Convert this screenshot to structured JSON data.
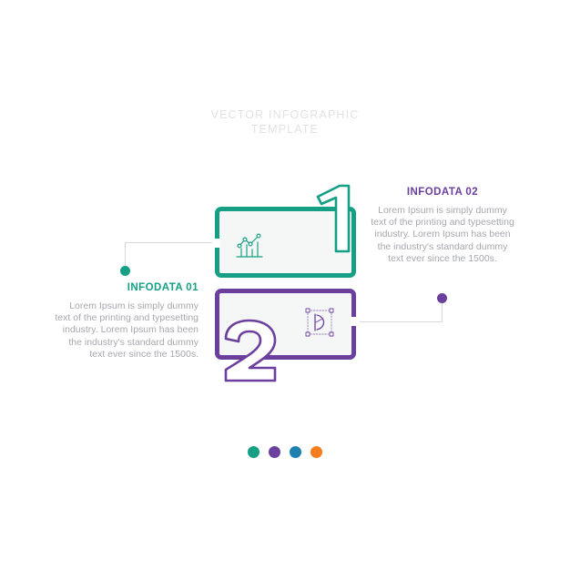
{
  "header": {
    "title": "VECTOR INFOGRAPHIC\nTEMPLATE"
  },
  "colors": {
    "teal": "#15a085",
    "purple": "#6b3f9e",
    "blue": "#1f7fae",
    "orange": "#f57d1f",
    "body_text": "#a7a8ad",
    "title_text": "#e2e2e4",
    "card_fill": "#f5f6f6",
    "connector_line": "#d8d8dc"
  },
  "steps": [
    {
      "number": "1",
      "heading": "INFODATA 01",
      "body": "Lorem Ipsum is simply dummy text of the printing and typesetting industry. Lorem Ipsum has been the industry's standard dummy text ever since the 1500s.",
      "icon": "growth-chart-icon",
      "accent": "#15a085"
    },
    {
      "number": "2",
      "heading": "INFODATA 02",
      "body": "Lorem Ipsum is simply dummy text of the printing and typesetting industry. Lorem Ipsum has been the industry's standard dummy text ever since the 1500s.",
      "icon": "vector-path-icon",
      "accent": "#6b3f9e"
    }
  ],
  "footer": {
    "dots": [
      {
        "color": "#15a085",
        "name": "footer-dot-teal"
      },
      {
        "color": "#6b3f9e",
        "name": "footer-dot-purple"
      },
      {
        "color": "#1f7fae",
        "name": "footer-dot-blue"
      },
      {
        "color": "#f57d1f",
        "name": "footer-dot-orange"
      }
    ]
  }
}
